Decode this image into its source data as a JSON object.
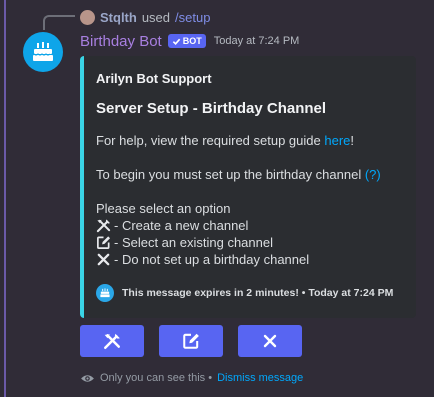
{
  "reply": {
    "user": "Stqlth",
    "used_text": "used",
    "command": "/setup"
  },
  "message": {
    "author": "Birthday Bot",
    "tag": "BOT",
    "timestamp": "Today at 7:24 PM"
  },
  "embed": {
    "accent_color": "#3ad4e6",
    "author": "Arilyn Bot Support",
    "title": "Server Setup - Birthday Channel",
    "help_prefix": "For help, view the required setup guide ",
    "help_link": "here",
    "help_suffix": "!",
    "begin_text": "To begin you must set up the birthday channel ",
    "begin_link": "(?)",
    "select_prompt": "Please select an option",
    "options": [
      {
        "icon": "tools-icon",
        "label": "- Create a new channel"
      },
      {
        "icon": "edit-icon",
        "label": "- Select an existing channel"
      },
      {
        "icon": "close-icon",
        "label": "- Do not set up a birthday channel"
      }
    ],
    "footer": "This message expires in 2 minutes! • Today at 7:24 PM"
  },
  "buttons": [
    {
      "icon": "tools-icon"
    },
    {
      "icon": "edit-icon"
    },
    {
      "icon": "close-icon"
    }
  ],
  "ephemeral": {
    "text": "Only you can see this • ",
    "dismiss": "Dismiss message"
  },
  "colors": {
    "background": "#302c37",
    "blurple": "#5865f2",
    "bot_name": "#a87fe0",
    "link": "#00a8fc"
  }
}
